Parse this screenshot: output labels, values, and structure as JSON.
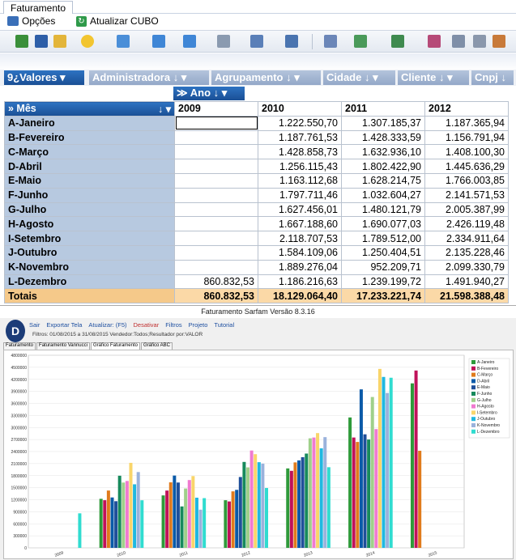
{
  "top_window": {
    "tab_label": "Faturamento",
    "menu": {
      "options_label": "Opções",
      "refresh_label": "Atualizar CUBO"
    },
    "fields": {
      "values_label": "9¿Valores",
      "filters": [
        "Administradora",
        "Agrupamento",
        "Cidade",
        "Cliente",
        "Cnpj"
      ],
      "column_field": "Ano",
      "row_field": "» Mês"
    },
    "pivot": {
      "columns": [
        "2009",
        "2010",
        "2011",
        "2012"
      ],
      "rows": [
        {
          "month": "A-Janeiro",
          "values": [
            "",
            "1.222.550,70",
            "1.307.185,37",
            "1.187.365,94"
          ]
        },
        {
          "month": "B-Fevereiro",
          "values": [
            "",
            "1.187.761,53",
            "1.428.333,59",
            "1.156.791,94"
          ]
        },
        {
          "month": "C-Março",
          "values": [
            "",
            "1.428.858,73",
            "1.632.936,10",
            "1.408.100,30"
          ]
        },
        {
          "month": "D-Abril",
          "values": [
            "",
            "1.256.115,43",
            "1.802.422,90",
            "1.445.636,29"
          ]
        },
        {
          "month": "E-Maio",
          "values": [
            "",
            "1.163.112,68",
            "1.628.214,75",
            "1.766.003,85"
          ]
        },
        {
          "month": "F-Junho",
          "values": [
            "",
            "1.797.711,46",
            "1.032.604,27",
            "2.141.571,53"
          ]
        },
        {
          "month": "G-Julho",
          "values": [
            "",
            "1.627.456,01",
            "1.480.121,79",
            "2.005.387,99"
          ]
        },
        {
          "month": "H-Agosto",
          "values": [
            "",
            "1.667.188,60",
            "1.690.077,03",
            "2.426.119,48"
          ]
        },
        {
          "month": "I-Setembro",
          "values": [
            "",
            "2.118.707,53",
            "1.789.512,00",
            "2.334.911,64"
          ]
        },
        {
          "month": "J-Outubro",
          "values": [
            "",
            "1.584.109,06",
            "1.250.404,51",
            "2.135.228,46"
          ]
        },
        {
          "month": "K-Novembro",
          "values": [
            "",
            "1.889.276,04",
            "952.209,71",
            "2.099.330,79"
          ]
        },
        {
          "month": "L-Dezembro",
          "values": [
            "860.832,53",
            "1.186.216,63",
            "1.239.199,72",
            "1.491.940,27"
          ]
        }
      ],
      "totals_label": "Totais",
      "totals": [
        "860.832,53",
        "18.129.064,40",
        "17.233.221,74",
        "21.598.388,48"
      ]
    }
  },
  "bottom_window": {
    "title": "Faturamento Sarfam Versão 8.3.16",
    "logo_letter": "D",
    "menu": [
      "Sair",
      "Exportar Tela",
      "Atualizar: (F5)",
      "Desativar",
      "Filtros",
      "Projeto",
      "Tutorial"
    ],
    "filter_text": "Filtros: 01/08/2015 a 31/08/2015 Vendedor:Todos;Resultador por:VALOR",
    "tabs": [
      "Faturamento",
      "Faturamento Vannucci",
      "Gráfico Faturamento",
      "Gráfico ABC"
    ],
    "active_tab": 2
  },
  "chart_data": {
    "type": "bar",
    "categories": [
      "2009",
      "2010",
      "2011",
      "2012",
      "2013",
      "2014",
      "2015"
    ],
    "ylim": [
      0,
      4800000
    ],
    "y_ticks": [
      0,
      300000,
      600000,
      900000,
      1200000,
      1500000,
      1800000,
      2100000,
      2400000,
      2700000,
      3000000,
      3300000,
      3600000,
      3900000,
      4200000,
      4500000,
      4800000
    ],
    "grid": true,
    "legend_position": "right",
    "series": [
      {
        "name": "A-Janeiro",
        "color": "#2e9a3a",
        "values": [
          0,
          1222551,
          1307185,
          1187366,
          1980000,
          3250000,
          4100000
        ]
      },
      {
        "name": "B-Fevereiro",
        "color": "#c0125a",
        "values": [
          0,
          1187762,
          1428334,
          1156792,
          1920000,
          2750000,
          4420000
        ]
      },
      {
        "name": "C-Março",
        "color": "#e07b1c",
        "values": [
          0,
          1428859,
          1632936,
          1408100,
          2130000,
          2640000,
          2420000
        ]
      },
      {
        "name": "D-Abril",
        "color": "#0a5aa8",
        "values": [
          0,
          1256115,
          1802423,
          1445636,
          2180000,
          3950000,
          0
        ]
      },
      {
        "name": "E-Maio",
        "color": "#1f4f9a",
        "values": [
          0,
          1163113,
          1628215,
          1766004,
          2260000,
          2830000,
          0
        ]
      },
      {
        "name": "F-Junho",
        "color": "#178a5c",
        "values": [
          0,
          1797711,
          1032604,
          2141572,
          2350000,
          2700000,
          0
        ]
      },
      {
        "name": "G-Julho",
        "color": "#9fd08a",
        "values": [
          0,
          1627456,
          1480122,
          2005388,
          2730000,
          3760000,
          0
        ]
      },
      {
        "name": "H-Agosto",
        "color": "#f07ad0",
        "values": [
          0,
          1667189,
          1690077,
          2426119,
          2750000,
          2960000,
          0
        ]
      },
      {
        "name": "I-Setembro",
        "color": "#f9d56a",
        "values": [
          0,
          2118708,
          1789512,
          2334912,
          2860000,
          4460000,
          0
        ]
      },
      {
        "name": "J-Outubro",
        "color": "#20b8e0",
        "values": [
          0,
          1584109,
          1250405,
          2135228,
          2480000,
          4260000,
          0
        ]
      },
      {
        "name": "K-Novembro",
        "color": "#9ab2dc",
        "values": [
          0,
          1889276,
          952210,
          2099331,
          2760000,
          3860000,
          0
        ]
      },
      {
        "name": "L-Dezembro",
        "color": "#30dcd0",
        "values": [
          860833,
          1186217,
          1239200,
          1491940,
          2010000,
          4240000,
          0
        ]
      }
    ]
  }
}
